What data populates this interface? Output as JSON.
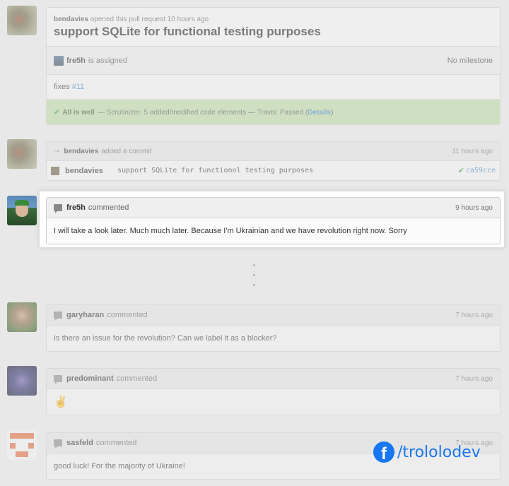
{
  "pr": {
    "author": "bendavies",
    "opened_text": "opened this pull request",
    "opened_time": "10 hours ago",
    "title": "support SQLite for functional testing purposes",
    "assignee": "fre5h",
    "assigned_text": "is assigned",
    "milestone": "No milestone",
    "body_prefix": "fixes",
    "body_link": "#11",
    "status_strong": "All is well",
    "status_text": "— Scrutinizer: 5 added/modified code elements — Travis: Passed (",
    "status_link": "Details",
    "status_suffix": ")"
  },
  "commit_event": {
    "author": "bendavies",
    "action": "added a commit",
    "time": "11 hours ago",
    "committer": "bendavies",
    "message": "support SQLite for functionol testing purposes",
    "sha": "ca59cce"
  },
  "comments": [
    {
      "author": "fre5h",
      "action": "commented",
      "time": "9 hours ago",
      "text": "I will take a look later. Much much later. Because I'm Ukrainian and we have revolution right now. Sorry"
    },
    {
      "author": "garyharan",
      "action": "commented",
      "time": "7 hours ago",
      "text": "Is there an issue for the revolution? Can we label it as a blocker?"
    },
    {
      "author": "predominant",
      "action": "commented",
      "time": "7 hours ago",
      "text": "✌"
    },
    {
      "author": "sasfeld",
      "action": "commented",
      "time": "7 hours ago",
      "text": "good luck! For the majority of Ukraine!"
    }
  ],
  "watermark": {
    "logo_letter": "f",
    "handle": "/trololodev",
    "color": "#1877f2"
  },
  "colors": {
    "status_green": "#b9dba2",
    "link_blue": "#4183c4",
    "check_green": "#3b9a34"
  }
}
